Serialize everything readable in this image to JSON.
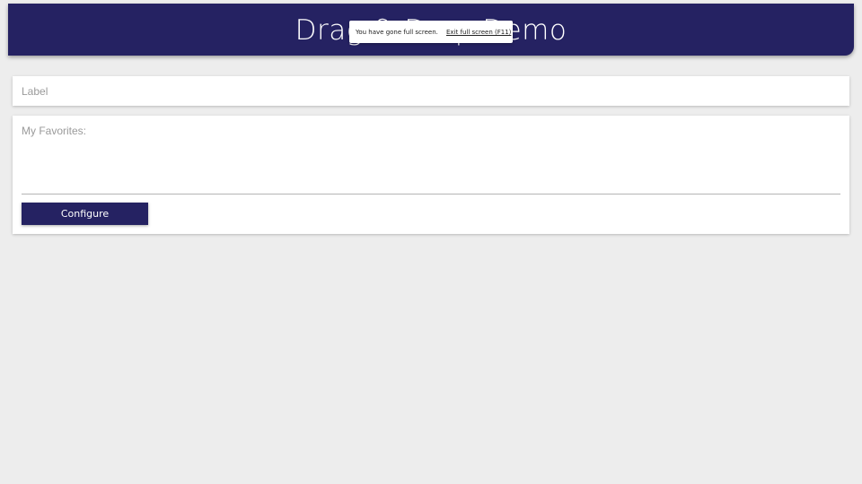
{
  "header": {
    "title": "Drag & Drop Demo"
  },
  "fullscreen_notice": {
    "message": "You have gone full screen.",
    "exit_link": "Exit full screen (F11)"
  },
  "label_field": {
    "placeholder": "Label",
    "value": ""
  },
  "favorites": {
    "title": "My Favorites:",
    "items": []
  },
  "configure_button": {
    "label": "Configure"
  },
  "colors": {
    "brand": "#252262",
    "page_background": "#ededed",
    "card_background": "#ffffff",
    "muted_text": "#9a9a9a"
  }
}
